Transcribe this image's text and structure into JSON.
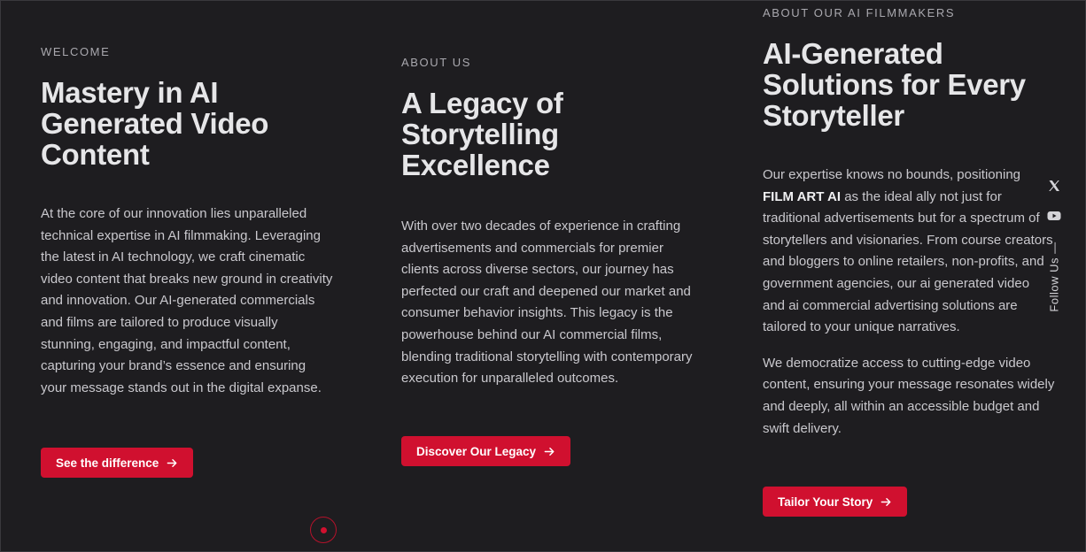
{
  "sections": [
    {
      "eyebrow": "WELCOME",
      "heading_lines": [
        "Mastery in AI",
        "Generated Video",
        "Content"
      ],
      "paragraph": "At the core of our innovation lies unparalleled technical expertise in AI filmmaking. Leveraging the latest in AI technology, we craft cinematic video content that breaks new ground in creativity and innovation. Our AI-generated commercials and films are tailored to produce visually stunning, engaging, and impactful content, capturing your brand’s essence and ensuring your message stands out in the digital expanse.",
      "button_label": "See the difference"
    },
    {
      "eyebrow": "ABOUT US",
      "heading_lines": [
        "A Legacy of",
        "Storytelling",
        "Excellence"
      ],
      "paragraph": "With over two decades of experience in crafting advertisements and commercials for premier clients across diverse sectors, our journey has perfected our craft and deepened our market and consumer behavior insights. This legacy is the powerhouse behind our AI commercial films, blending traditional storytelling with contemporary execution for unparalleled outcomes.",
      "button_label": "Discover Our Legacy"
    },
    {
      "eyebrow": "ABOUT OUR AI FILMMAKERS",
      "heading_lines": [
        "AI-Generated",
        "Solutions for Every",
        "Storyteller"
      ],
      "paragraph_lead": "Our expertise knows no bounds, positioning",
      "paragraph_brand": "FILM ART AI",
      "paragraph_rest": "as the ideal ally not just for traditional advertisements but for a spectrum of storytellers and visionaries. From course creators and bloggers to online retailers, non-profits, and government agencies, our ai generated video and ai commercial advertising solutions are tailored to your unique narratives.",
      "paragraph2": "We democratize access to cutting-edge video content, ensuring your message resonates widely and deeply, all within an accessible budget and swift delivery.",
      "button_label": "Tailor Your Story"
    }
  ],
  "social": {
    "follow_label": "Follow Us —",
    "icons": [
      "x-icon",
      "youtube-icon"
    ]
  },
  "colors": {
    "background": "#1e1d20",
    "accent": "#d0102f",
    "heading": "#e6e6e8",
    "body_text": "#c9c8cd",
    "eyebrow": "#a9a8ae"
  }
}
